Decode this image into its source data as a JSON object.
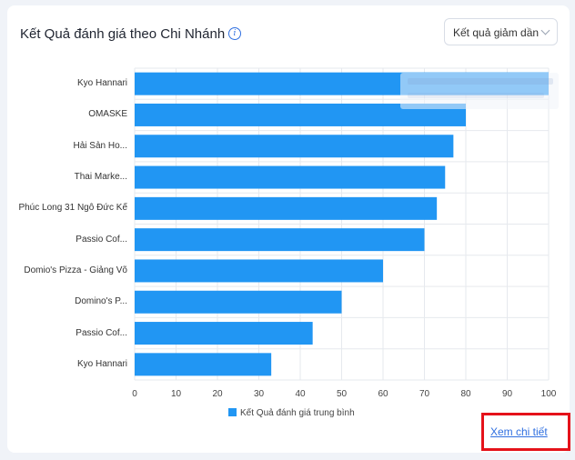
{
  "header": {
    "title": "Kết Quả đánh giá theo Chi Nhánh",
    "info_icon": "info-icon"
  },
  "sort": {
    "selected": "Kết quả giảm dần",
    "icon": "chevron-down-icon"
  },
  "chart_data": {
    "type": "bar",
    "orientation": "horizontal",
    "categories": [
      "Kyo Hannari",
      "OMASKE",
      "Hải Sản Ho...",
      "Thai Marke...",
      "Phúc Long 31 Ngô Đức Kế",
      "Passio Cof...",
      "Domio's Pizza - Giảng Võ",
      "Domino's P...",
      "Passio Cof...",
      "Kyo Hannari"
    ],
    "series": [
      {
        "name": "Kết Quả đánh giá trung bình",
        "values": [
          100,
          80,
          77,
          75,
          73,
          70,
          60,
          50,
          43,
          33
        ]
      }
    ],
    "xlim": [
      0,
      100
    ],
    "xticks": [
      0,
      10,
      20,
      30,
      40,
      50,
      60,
      70,
      80,
      90,
      100
    ],
    "grid": "vertical",
    "legend": "bottom",
    "bar_color": "#2196f3"
  },
  "footer": {
    "detail_link": "Xem chi tiết"
  },
  "colors": {
    "accent": "#2f6fe0",
    "bar": "#2196f3",
    "highlight_border": "#e5121a"
  }
}
